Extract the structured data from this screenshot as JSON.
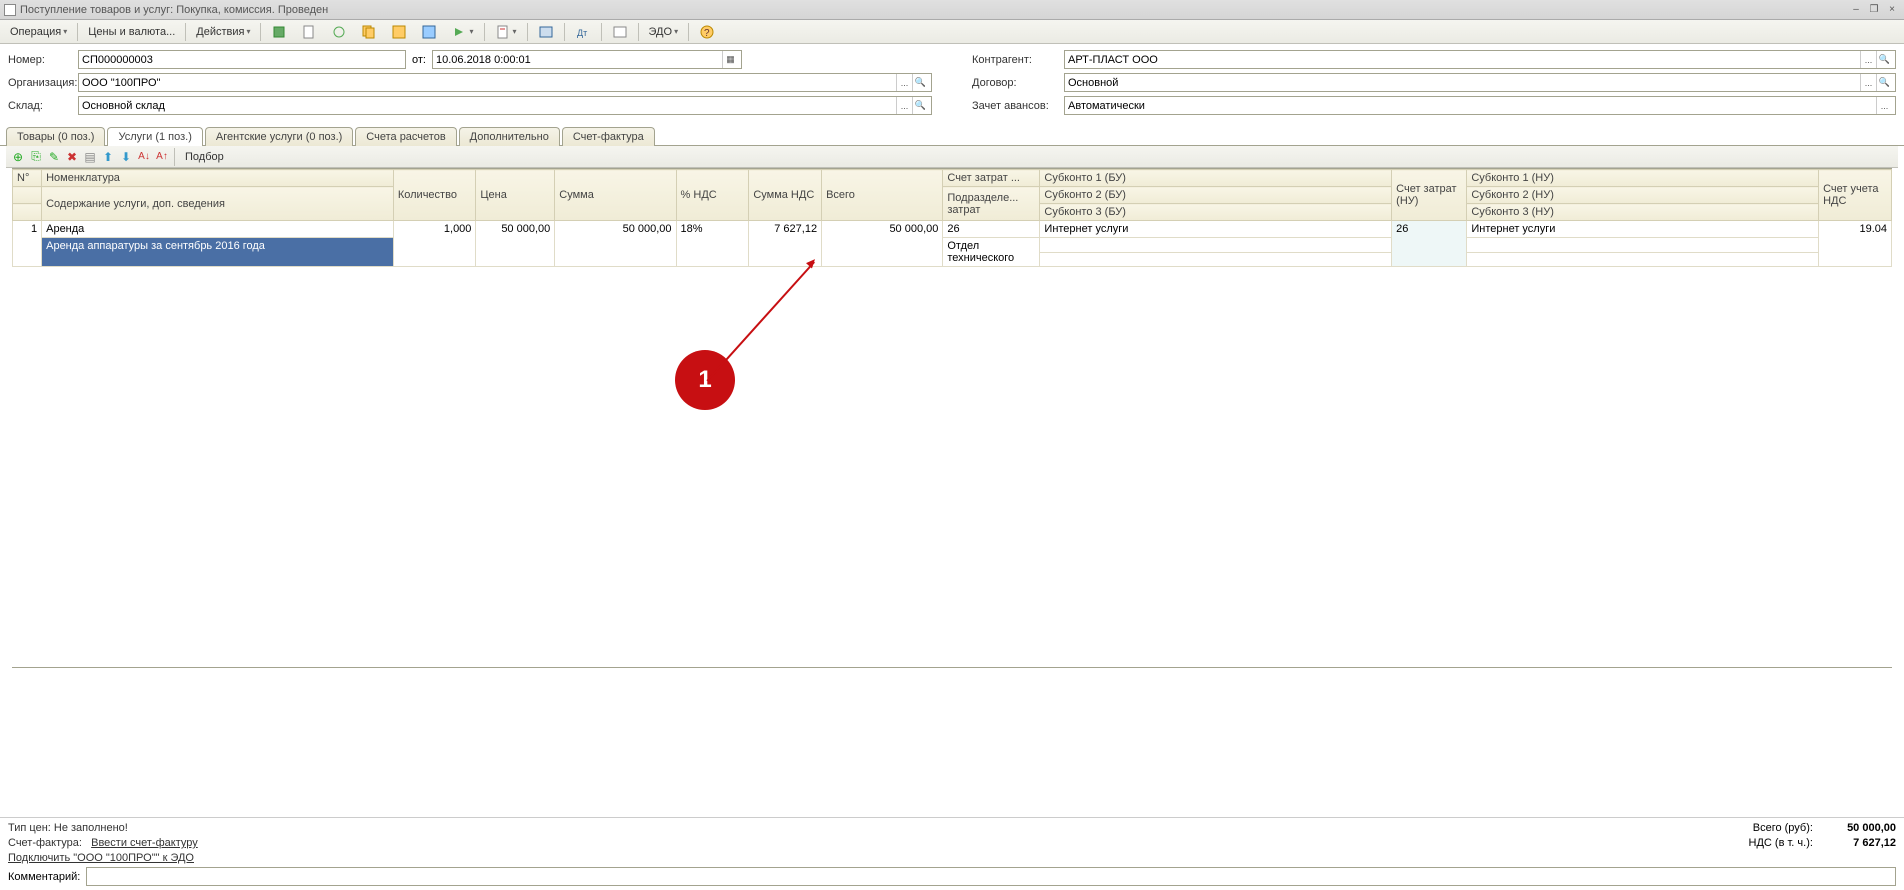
{
  "window": {
    "title": "Поступление товаров и услуг: Покупка, комиссия. Проведен"
  },
  "toolbar": {
    "operation": "Операция",
    "prices": "Цены и валюта...",
    "actions": "Действия",
    "edo": "ЭДО"
  },
  "form": {
    "number_lbl": "Номер:",
    "number": "СП000000003",
    "from_lbl": "от:",
    "date": "10.06.2018 0:00:01",
    "org_lbl": "Организация:",
    "org": "ООО \"100ПРО\"",
    "sklad_lbl": "Склад:",
    "sklad": "Основной склад",
    "contr_lbl": "Контрагент:",
    "contr": "АРТ-ПЛАСТ ООО",
    "dogovor_lbl": "Договор:",
    "dogovor": "Основной",
    "zachet_lbl": "Зачет авансов:",
    "zachet": "Автоматически"
  },
  "tabs": [
    {
      "label": "Товары (0 поз.)",
      "active": false
    },
    {
      "label": "Услуги (1 поз.)",
      "active": true
    },
    {
      "label": "Агентские услуги (0 поз.)",
      "active": false
    },
    {
      "label": "Счета расчетов",
      "active": false
    },
    {
      "label": "Дополнительно",
      "active": false
    },
    {
      "label": "Счет-фактура",
      "active": false
    }
  ],
  "gridbar": {
    "podbor": "Подбор"
  },
  "headers": {
    "n": "N°",
    "nomen": "Номенклатура",
    "nomen_sub": "Содержание услуги, доп. сведения",
    "qty": "Количество",
    "price": "Цена",
    "sum": "Сумма",
    "nds_pct": "% НДС",
    "nds_sum": "Сумма НДС",
    "total": "Всего",
    "zatrat": "Счет затрат ...",
    "zatrat_sub": "Подразделе... затрат",
    "sub1bu": "Субконто 1 (БУ)",
    "sub2bu": "Субконто 2 (БУ)",
    "sub3bu": "Субконто 3 (БУ)",
    "zatrat_nu": "Счет затрат (НУ)",
    "sub1nu": "Субконто 1 (НУ)",
    "sub2nu": "Субконто 2 (НУ)",
    "sub3nu": "Субконто 3 (НУ)",
    "nds_acc": "Счет учета НДС"
  },
  "row": {
    "n": "1",
    "nomen": "Аренда",
    "nomen_sub": "Аренда аппаратуры за сентябрь 2016 года",
    "qty": "1,000",
    "price": "50 000,00",
    "sum": "50 000,00",
    "nds_pct": "18%",
    "nds_sum": "7 627,12",
    "total": "50 000,00",
    "zatrat": "26",
    "zatrat_sub": "Отдел технического",
    "sub1bu": "Интернет услуги",
    "zatrat_nu": "26",
    "sub1nu": "Интернет услуги",
    "nds_acc": "19.04"
  },
  "annotation": {
    "label": "1"
  },
  "footer": {
    "tip": "Тип цен: Не заполнено!",
    "sf_lbl": "Счет-фактура:",
    "sf_link": "Ввести счет-фактуру",
    "edo_link": "Подключить \"ООО \"100ПРО\"\" к ЭДО",
    "total_lbl": "Всего (руб):",
    "total_val": "50 000,00",
    "nds_lbl": "НДС (в т. ч.):",
    "nds_val": "7 627,12",
    "comment_lbl": "Комментарий:"
  }
}
